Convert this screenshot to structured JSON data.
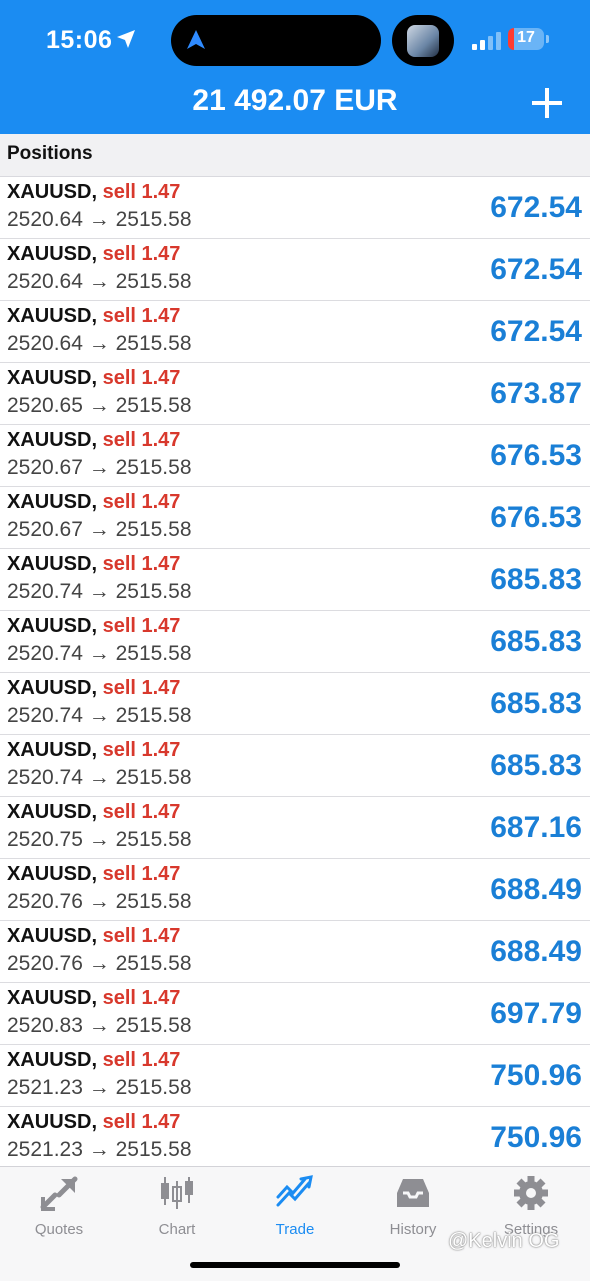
{
  "status_bar": {
    "time": "15:06",
    "battery": "17",
    "battery_level": 0.17
  },
  "header": {
    "balance": "21 492.07 EUR"
  },
  "section": {
    "title": "Positions"
  },
  "positions": [
    {
      "symbol": "XAUUSD",
      "side": "sell 1.47",
      "open": "2520.64",
      "current": "2515.58",
      "profit": "672.54"
    },
    {
      "symbol": "XAUUSD",
      "side": "sell 1.47",
      "open": "2520.64",
      "current": "2515.58",
      "profit": "672.54"
    },
    {
      "symbol": "XAUUSD",
      "side": "sell 1.47",
      "open": "2520.64",
      "current": "2515.58",
      "profit": "672.54"
    },
    {
      "symbol": "XAUUSD",
      "side": "sell 1.47",
      "open": "2520.65",
      "current": "2515.58",
      "profit": "673.87"
    },
    {
      "symbol": "XAUUSD",
      "side": "sell 1.47",
      "open": "2520.67",
      "current": "2515.58",
      "profit": "676.53"
    },
    {
      "symbol": "XAUUSD",
      "side": "sell 1.47",
      "open": "2520.67",
      "current": "2515.58",
      "profit": "676.53"
    },
    {
      "symbol": "XAUUSD",
      "side": "sell 1.47",
      "open": "2520.74",
      "current": "2515.58",
      "profit": "685.83"
    },
    {
      "symbol": "XAUUSD",
      "side": "sell 1.47",
      "open": "2520.74",
      "current": "2515.58",
      "profit": "685.83"
    },
    {
      "symbol": "XAUUSD",
      "side": "sell 1.47",
      "open": "2520.74",
      "current": "2515.58",
      "profit": "685.83"
    },
    {
      "symbol": "XAUUSD",
      "side": "sell 1.47",
      "open": "2520.74",
      "current": "2515.58",
      "profit": "685.83"
    },
    {
      "symbol": "XAUUSD",
      "side": "sell 1.47",
      "open": "2520.75",
      "current": "2515.58",
      "profit": "687.16"
    },
    {
      "symbol": "XAUUSD",
      "side": "sell 1.47",
      "open": "2520.76",
      "current": "2515.58",
      "profit": "688.49"
    },
    {
      "symbol": "XAUUSD",
      "side": "sell 1.47",
      "open": "2520.76",
      "current": "2515.58",
      "profit": "688.49"
    },
    {
      "symbol": "XAUUSD",
      "side": "sell 1.47",
      "open": "2520.83",
      "current": "2515.58",
      "profit": "697.79"
    },
    {
      "symbol": "XAUUSD",
      "side": "sell 1.47",
      "open": "2521.23",
      "current": "2515.58",
      "profit": "750.96"
    },
    {
      "symbol": "XAUUSD",
      "side": "sell 1.47",
      "open": "2521.23",
      "current": "2515.58",
      "profit": "750.96"
    }
  ],
  "tabs": [
    {
      "label": "Quotes",
      "icon": "quotes-icon",
      "active": false
    },
    {
      "label": "Chart",
      "icon": "candlestick-chart-icon",
      "active": false
    },
    {
      "label": "Trade",
      "icon": "trade-trend-icon",
      "active": true
    },
    {
      "label": "History",
      "icon": "history-tray-icon",
      "active": false
    },
    {
      "label": "Settings",
      "icon": "gear-icon",
      "active": false
    }
  ],
  "watermark": "@Kelvin OG",
  "colors": {
    "header_bg": "#1b8cf2",
    "sell": "#d8382c",
    "profit": "#1a7fd6",
    "tab_active": "#1b8cf2",
    "tab_inactive": "#8e8e93"
  }
}
